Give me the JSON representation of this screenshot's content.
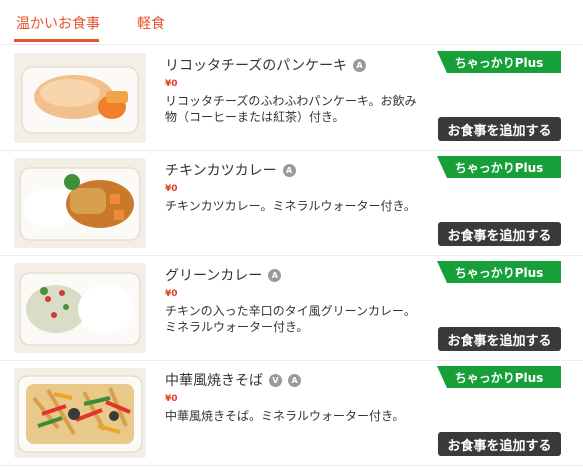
{
  "tabs": [
    {
      "label": "温かいお食事"
    },
    {
      "label": "軽食"
    }
  ],
  "items": [
    {
      "name": "リコッタチーズのパンケーキ",
      "badges": [
        "A"
      ],
      "price": "¥0",
      "description": "リコッタチーズのふわふわパンケーキ。お飲み物（コーヒーまたは紅茶）付き。",
      "tag": "ちゃっかりPlus",
      "button": "お食事を追加する"
    },
    {
      "name": "チキンカツカレー",
      "badges": [
        "A"
      ],
      "price": "¥0",
      "description": "チキンカツカレー。ミネラルウォーター付き。",
      "tag": "ちゃっかりPlus",
      "button": "お食事を追加する"
    },
    {
      "name": "グリーンカレー",
      "badges": [
        "A"
      ],
      "price": "¥0",
      "description": "チキンの入った辛口のタイ風グリーンカレー。ミネラルウォーター付き。",
      "tag": "ちゃっかりPlus",
      "button": "お食事を追加する"
    },
    {
      "name": "中華風焼きそば",
      "badges": [
        "V",
        "A"
      ],
      "price": "¥0",
      "description": "中華風焼きそば。ミネラルウォーター付き。",
      "tag": "ちゃっかりPlus",
      "button": "お食事を追加する"
    }
  ]
}
